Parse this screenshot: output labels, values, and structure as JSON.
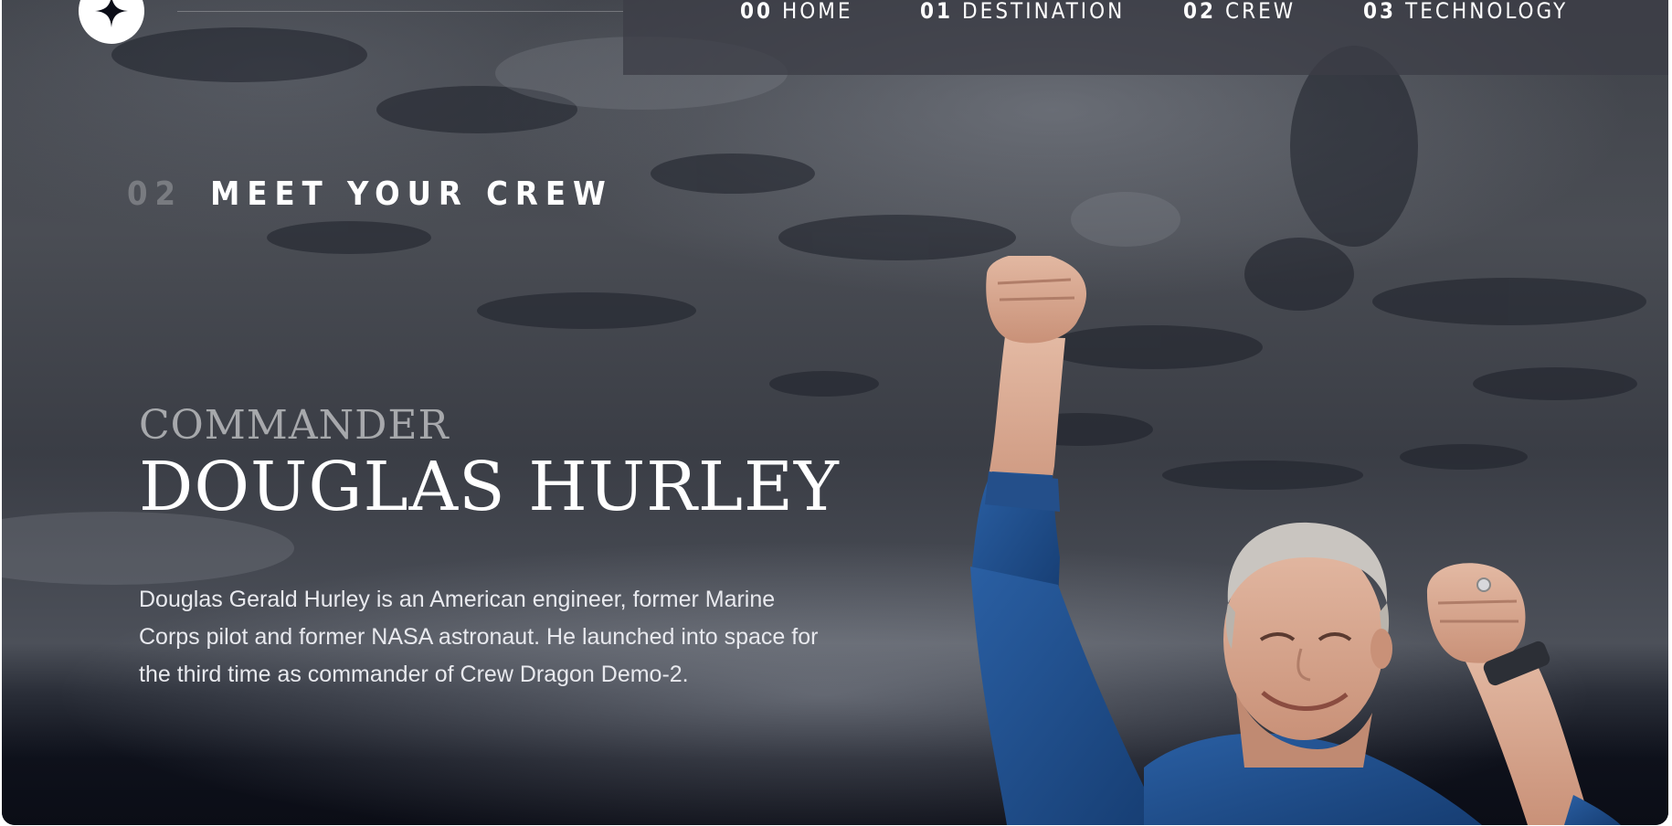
{
  "nav": {
    "items": [
      {
        "number": "00",
        "label": "HOME",
        "active": true
      },
      {
        "number": "01",
        "label": "DESTINATION",
        "active": false
      },
      {
        "number": "02",
        "label": "CREW",
        "active": false
      },
      {
        "number": "03",
        "label": "TECHNOLOGY",
        "active": false
      }
    ]
  },
  "page": {
    "heading_number": "02",
    "heading_text": "MEET YOUR CREW"
  },
  "crew": {
    "role": "COMMANDER",
    "name": "DOUGLAS HURLEY",
    "bio": "Douglas Gerald Hurley is an American engineer, former Marine Corps pilot and former NASA astronaut. He launched into space for the third time as commander of Crew Dragon Demo-2."
  },
  "colors": {
    "text": "#ffffff",
    "nav_background": "#3c3e46",
    "shirt": "#1f4f8f"
  },
  "icons": {
    "logo": "star-logo-icon"
  }
}
